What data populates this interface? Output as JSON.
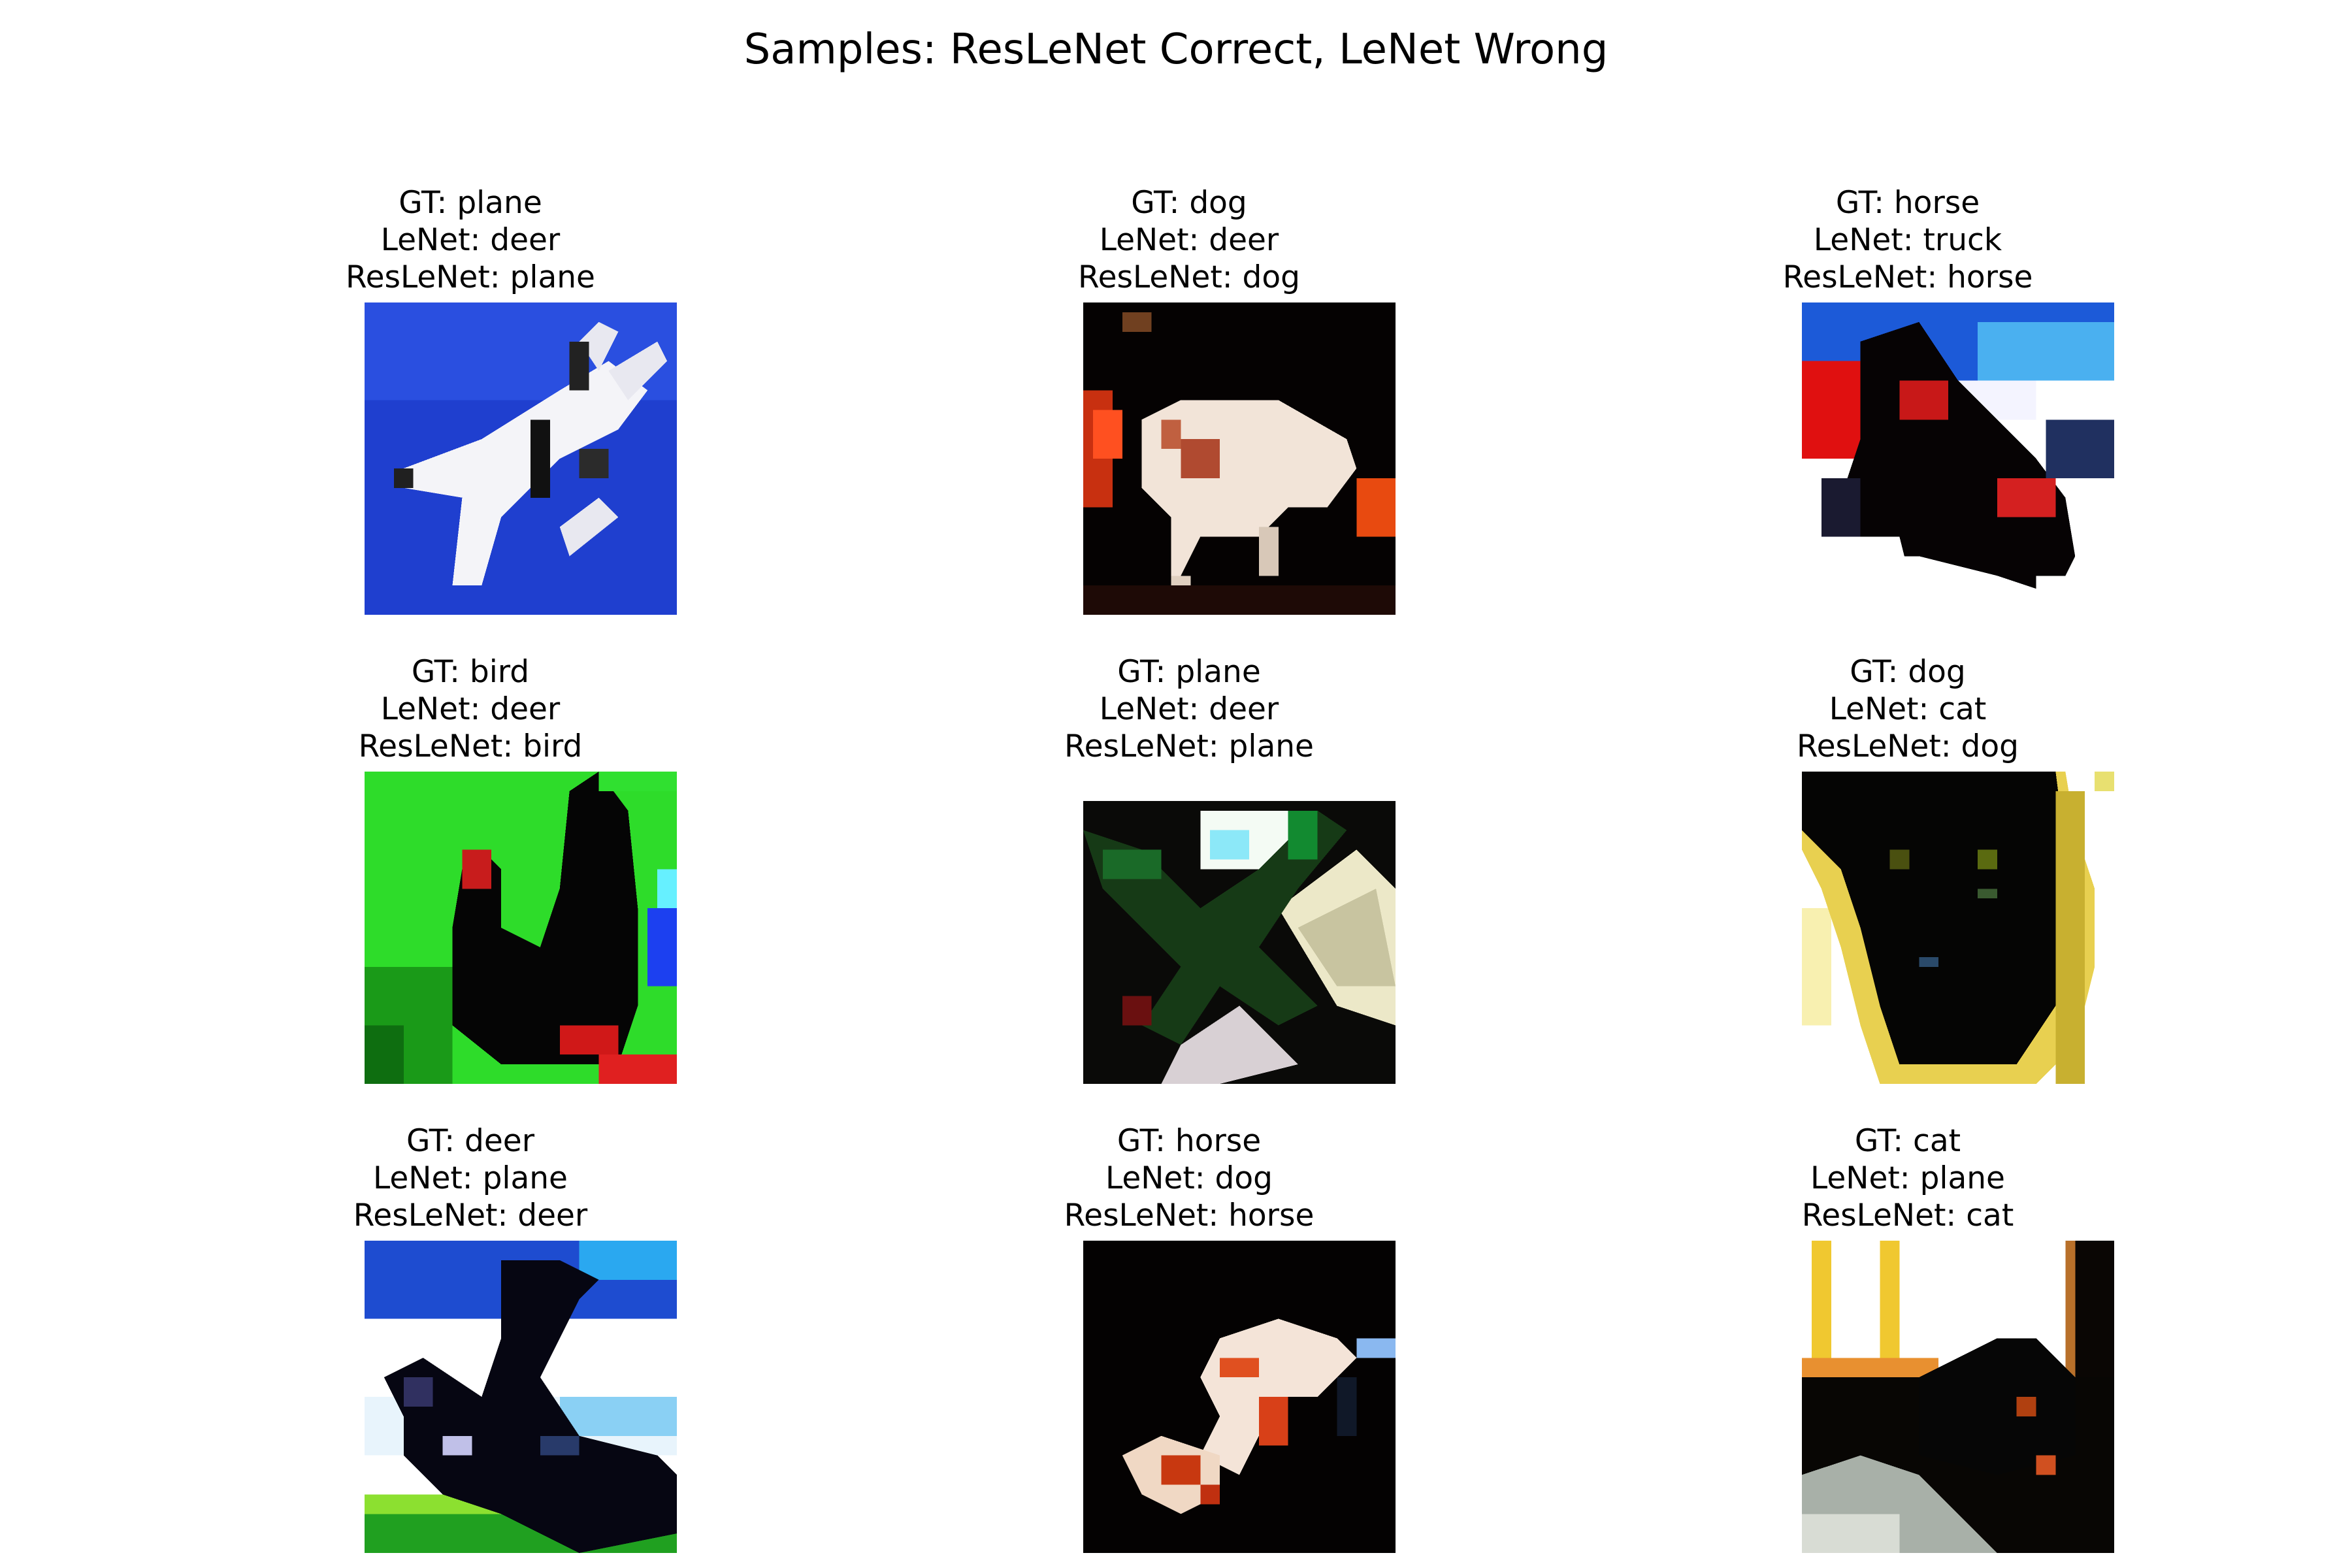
{
  "figure": {
    "title": "Samples: ResLeNet Correct, LeNet Wrong"
  },
  "samples": [
    {
      "gt": "GT: plane",
      "lenet": "LeNet: deer",
      "reslenet": "ResLeNet: plane",
      "image": "airplane-on-blue-sky"
    },
    {
      "gt": "GT: dog",
      "lenet": "LeNet: deer",
      "reslenet": "ResLeNet: dog",
      "image": "dog-on-dark-background"
    },
    {
      "gt": "GT: horse",
      "lenet": "LeNet: truck",
      "reslenet": "ResLeNet: horse",
      "image": "horse-head-red-blue"
    },
    {
      "gt": "GT: bird",
      "lenet": "LeNet: deer",
      "reslenet": "ResLeNet: bird",
      "image": "bird-on-green-background"
    },
    {
      "gt": "GT: plane",
      "lenet": "LeNet: deer",
      "reslenet": "ResLeNet: plane",
      "image": "dark-airplane-silhouette"
    },
    {
      "gt": "GT: dog",
      "lenet": "LeNet: cat",
      "reslenet": "ResLeNet: dog",
      "image": "dark-dog-face"
    },
    {
      "gt": "GT: deer",
      "lenet": "LeNet: plane",
      "reslenet": "ResLeNet: deer",
      "image": "deer-silhouette-sky"
    },
    {
      "gt": "GT: horse",
      "lenet": "LeNet: dog",
      "reslenet": "ResLeNet: horse",
      "image": "horse-dark-orange"
    },
    {
      "gt": "GT: cat",
      "lenet": "LeNet: plane",
      "reslenet": "ResLeNet: cat",
      "image": "cat-dark-window"
    }
  ]
}
